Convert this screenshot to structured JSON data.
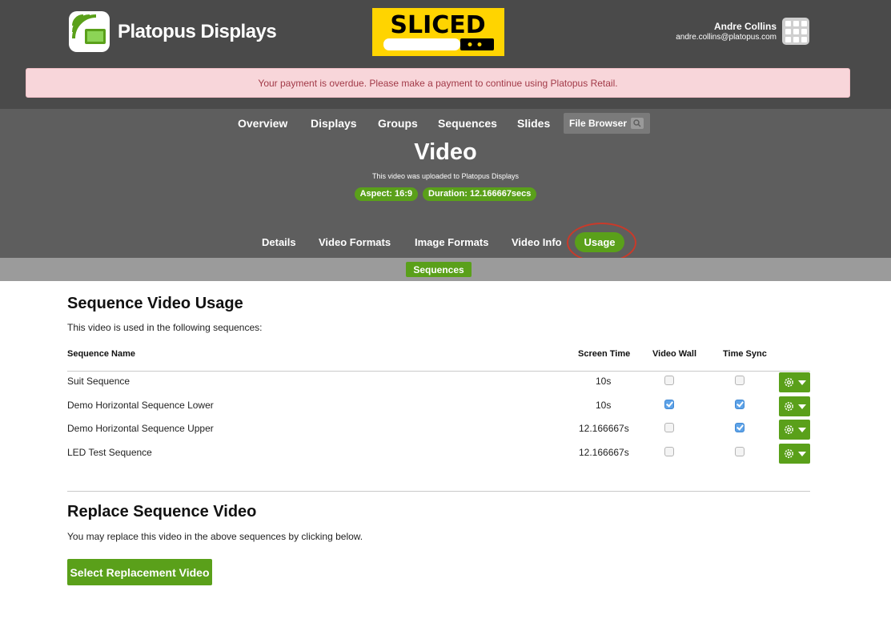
{
  "brand": {
    "name": "Platopus Displays",
    "logo_icon": "display-wave-icon"
  },
  "promo_logo": {
    "text": "SLICED",
    "colors": {
      "background": "#ffd400",
      "text": "#000000"
    }
  },
  "user": {
    "name": "Andre Collins",
    "email": "andre.collins@platopus.com",
    "apps_icon": "grid-apps-icon"
  },
  "alert": {
    "text": "Your payment is overdue. Please make a payment to continue using Platopus Retail."
  },
  "main_nav": [
    {
      "label": "Overview"
    },
    {
      "label": "Displays"
    },
    {
      "label": "Groups"
    },
    {
      "label": "Sequences"
    },
    {
      "label": "Slides"
    }
  ],
  "file_browser": {
    "label": "File Browser",
    "icon": "search-icon"
  },
  "page": {
    "title": "Video",
    "subtitle": "This video was uploaded to Platopus Displays",
    "badges": [
      "Aspect: 16:9",
      "Duration: 12.166667secs"
    ]
  },
  "sub_nav": [
    {
      "label": "Details"
    },
    {
      "label": "Video Formats"
    },
    {
      "label": "Image Formats"
    },
    {
      "label": "Video Info"
    },
    {
      "label": "Usage",
      "active": true
    }
  ],
  "usage_tabs": [
    {
      "label": "Sequences",
      "active": true
    }
  ],
  "usage_section": {
    "title": "Sequence Video Usage",
    "description": "This video is used in the following sequences:",
    "columns": {
      "name": "Sequence Name",
      "screen_time": "Screen Time",
      "video_wall": "Video Wall",
      "time_sync": "Time Sync"
    },
    "rows": [
      {
        "name": "Suit Sequence",
        "screen_time": "10s",
        "video_wall": false,
        "time_sync": false
      },
      {
        "name": "Demo Horizontal Sequence Lower",
        "screen_time": "10s",
        "video_wall": true,
        "time_sync": true
      },
      {
        "name": "Demo Horizontal Sequence Upper",
        "screen_time": "12.166667s",
        "video_wall": false,
        "time_sync": true
      },
      {
        "name": "LED Test Sequence",
        "screen_time": "12.166667s",
        "video_wall": false,
        "time_sync": false
      }
    ],
    "row_action_icon": "gear-icon"
  },
  "replace_section": {
    "title": "Replace Sequence Video",
    "description": "You may replace this video in the above sequences by clicking below.",
    "button_label": "Select Replacement Video"
  },
  "colors": {
    "accent": "#5aa01a",
    "header": "#4a4a4a",
    "subheader": "#5e5e5e",
    "alert_bg": "#f8d6da",
    "alert_text": "#a23a48",
    "highlight_circle": "#c93a2a"
  }
}
